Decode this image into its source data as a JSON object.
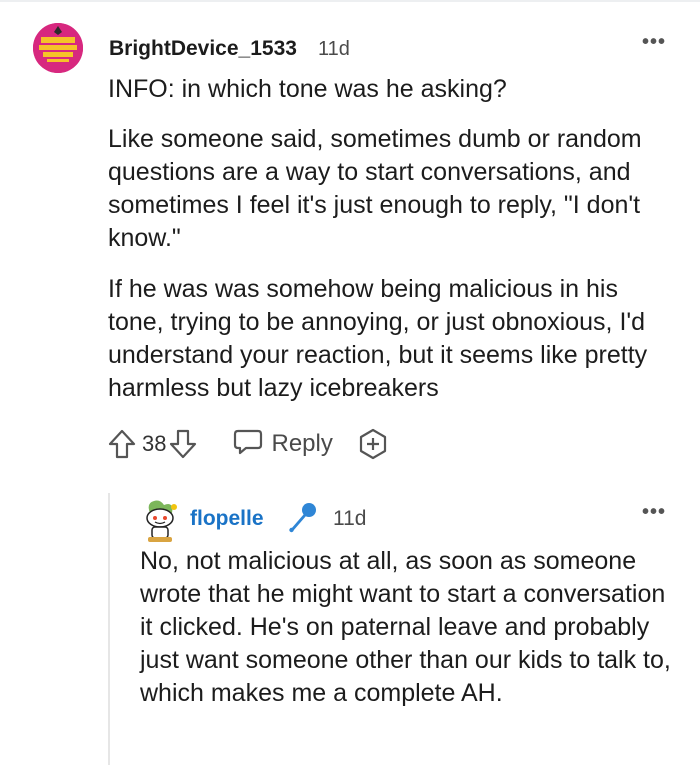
{
  "parent_comment": {
    "username": "BrightDevice_1533",
    "timestamp": "11d",
    "paragraphs": [
      "INFO: in which tone was he asking?",
      "Like someone said, sometimes dumb or random questions are a way to start conversations, and sometimes I feel it's just enough to reply, \"I don't know.\"",
      "If he was was somehow being malicious in his tone, trying to be annoying, or just obnoxious, I'd understand your reaction, but it seems like pretty harmless but lazy icebreakers"
    ],
    "vote_count": "38",
    "reply_label": "Reply",
    "more_label": "•••"
  },
  "reply_comment": {
    "username": "flopelle",
    "timestamp": "11d",
    "text": "No, not malicious at all, as soon as someone wrote that he might want to start a conversation it clicked. He's on paternal leave and probably just want someone other than our kids to talk to, which makes me a complete AH.",
    "more_label": "•••"
  },
  "colors": {
    "avatar_bg": "#d7287f",
    "username_blue": "#1a73c6",
    "text": "#1c1c1c",
    "muted": "#4a4a4a"
  },
  "icons": [
    "user-avatar",
    "more-options-icon",
    "upvote-icon",
    "downvote-icon",
    "comment-bubble-icon",
    "add-award-icon",
    "snoo-avatar",
    "microphone-icon"
  ]
}
